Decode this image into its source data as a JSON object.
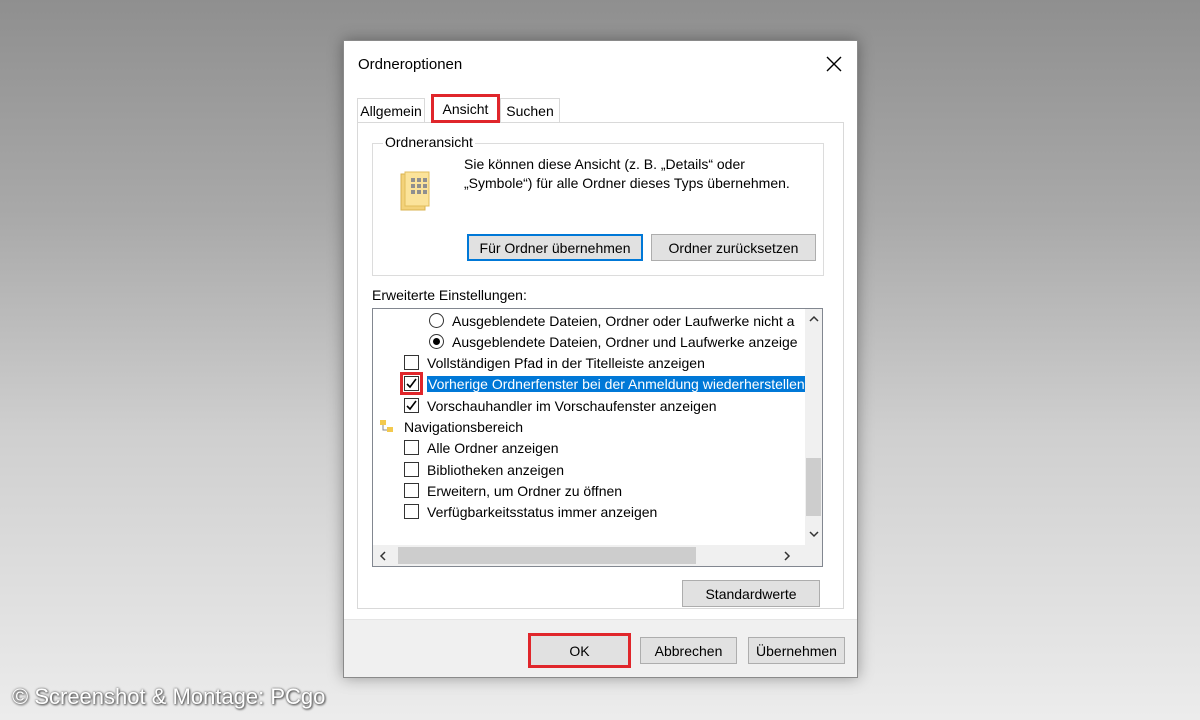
{
  "dialog": {
    "title": "Ordneroptionen",
    "tabs": [
      {
        "label": "Allgemein",
        "active": false
      },
      {
        "label": "Ansicht",
        "active": true
      },
      {
        "label": "Suchen",
        "active": false
      }
    ],
    "folder_view": {
      "legend": "Ordneransicht",
      "description": "Sie können diese Ansicht (z. B. „Details“ oder „Symbole“) für alle Ordner dieses Typs übernehmen.",
      "apply_button": "Für Ordner übernehmen",
      "reset_button": "Ordner zurücksetzen"
    },
    "advanced": {
      "label": "Erweiterte Einstellungen:",
      "items": [
        {
          "type": "radio",
          "checked": false,
          "label": "Ausgeblendete Dateien, Ordner oder Laufwerke nicht a"
        },
        {
          "type": "radio",
          "checked": true,
          "label": "Ausgeblendete Dateien, Ordner und Laufwerke anzeige"
        },
        {
          "type": "checkbox",
          "checked": false,
          "label": "Vollständigen Pfad in der Titelleiste anzeigen"
        },
        {
          "type": "checkbox",
          "checked": true,
          "selected": true,
          "label": "Vorherige Ordnerfenster bei der Anmeldung wiederherstellen"
        },
        {
          "type": "checkbox",
          "checked": true,
          "label": "Vorschauhandler im Vorschaufenster anzeigen"
        },
        {
          "type": "group",
          "label": "Navigationsbereich"
        },
        {
          "type": "checkbox",
          "checked": false,
          "label": "Alle Ordner anzeigen"
        },
        {
          "type": "checkbox",
          "checked": false,
          "label": "Bibliotheken anzeigen"
        },
        {
          "type": "checkbox",
          "checked": false,
          "label": "Erweitern, um Ordner zu öffnen"
        },
        {
          "type": "checkbox",
          "checked": false,
          "label": "Verfügbarkeitsstatus immer anzeigen"
        }
      ]
    },
    "defaults_button": "Standardwerte",
    "ok_button": "OK",
    "cancel_button": "Abbrechen",
    "apply_button": "Übernehmen"
  },
  "watermark": "© Screenshot & Montage: PCgo",
  "colors": {
    "highlight": "#e0262b",
    "selection": "#0078d7"
  },
  "icons": [
    "close-icon",
    "folder-view-icon",
    "navigation-folder-icon",
    "checkmark-icon",
    "scroll-up-icon",
    "scroll-down-icon",
    "scroll-left-icon",
    "scroll-right-icon"
  ]
}
